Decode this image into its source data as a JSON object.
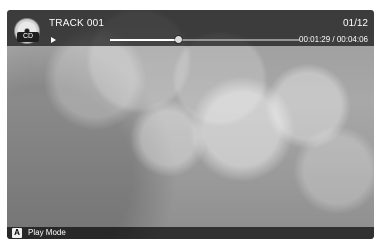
{
  "player": {
    "disc_label": "CD",
    "track_title": "TRACK 001",
    "track_count": "01/12",
    "time": "00:01:29 / 00:04:06",
    "progress_fraction": 0.36
  },
  "footer": {
    "key": "A",
    "label": "Play Mode"
  },
  "icons": {
    "disc": "cd-disc-icon",
    "play": "play-icon"
  }
}
